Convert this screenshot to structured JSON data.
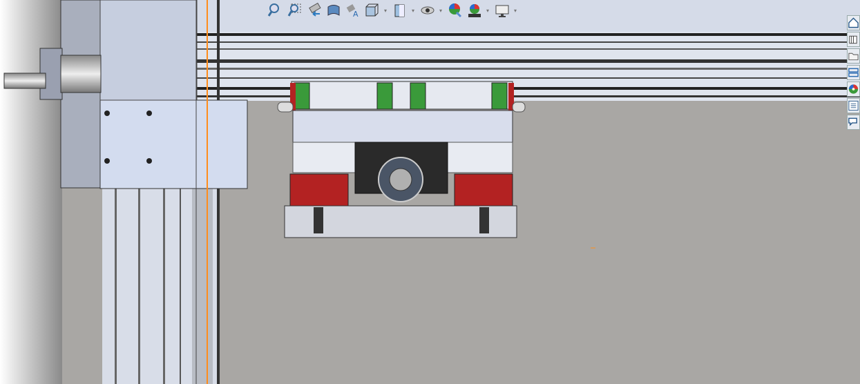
{
  "toolbar": {
    "items": [
      {
        "icon": "zoom-to-fit-icon",
        "dropdown": false
      },
      {
        "icon": "zoom-to-area-icon",
        "dropdown": false
      },
      {
        "icon": "previous-view-icon",
        "dropdown": false
      },
      {
        "icon": "section-view-icon",
        "dropdown": false
      },
      {
        "icon": "dynamic-annotation-views-icon",
        "dropdown": false
      },
      {
        "icon": "view-orientation-icon",
        "dropdown": true
      },
      {
        "icon": "display-style-icon",
        "dropdown": true
      },
      {
        "icon": "hide-show-items-icon",
        "dropdown": true
      },
      {
        "icon": "edit-appearance-icon",
        "dropdown": false
      },
      {
        "icon": "apply-scene-icon",
        "dropdown": true
      },
      {
        "icon": "view-settings-icon",
        "dropdown": true
      }
    ]
  },
  "task_pane": {
    "items": [
      "home-icon",
      "design-library-icon",
      "file-explorer-icon",
      "view-palette-icon",
      "appearances-scenes-icon",
      "custom-properties-icon",
      "forum-icon"
    ]
  },
  "colors": {
    "viewport_top": "#d5dbe8",
    "floor": "#a9a7a4",
    "rail_block_red": "#b32222",
    "carriage_green": "#3a9a3a",
    "axis_orange": "#ff8c1a",
    "bearing_black": "#2a2a2a"
  }
}
